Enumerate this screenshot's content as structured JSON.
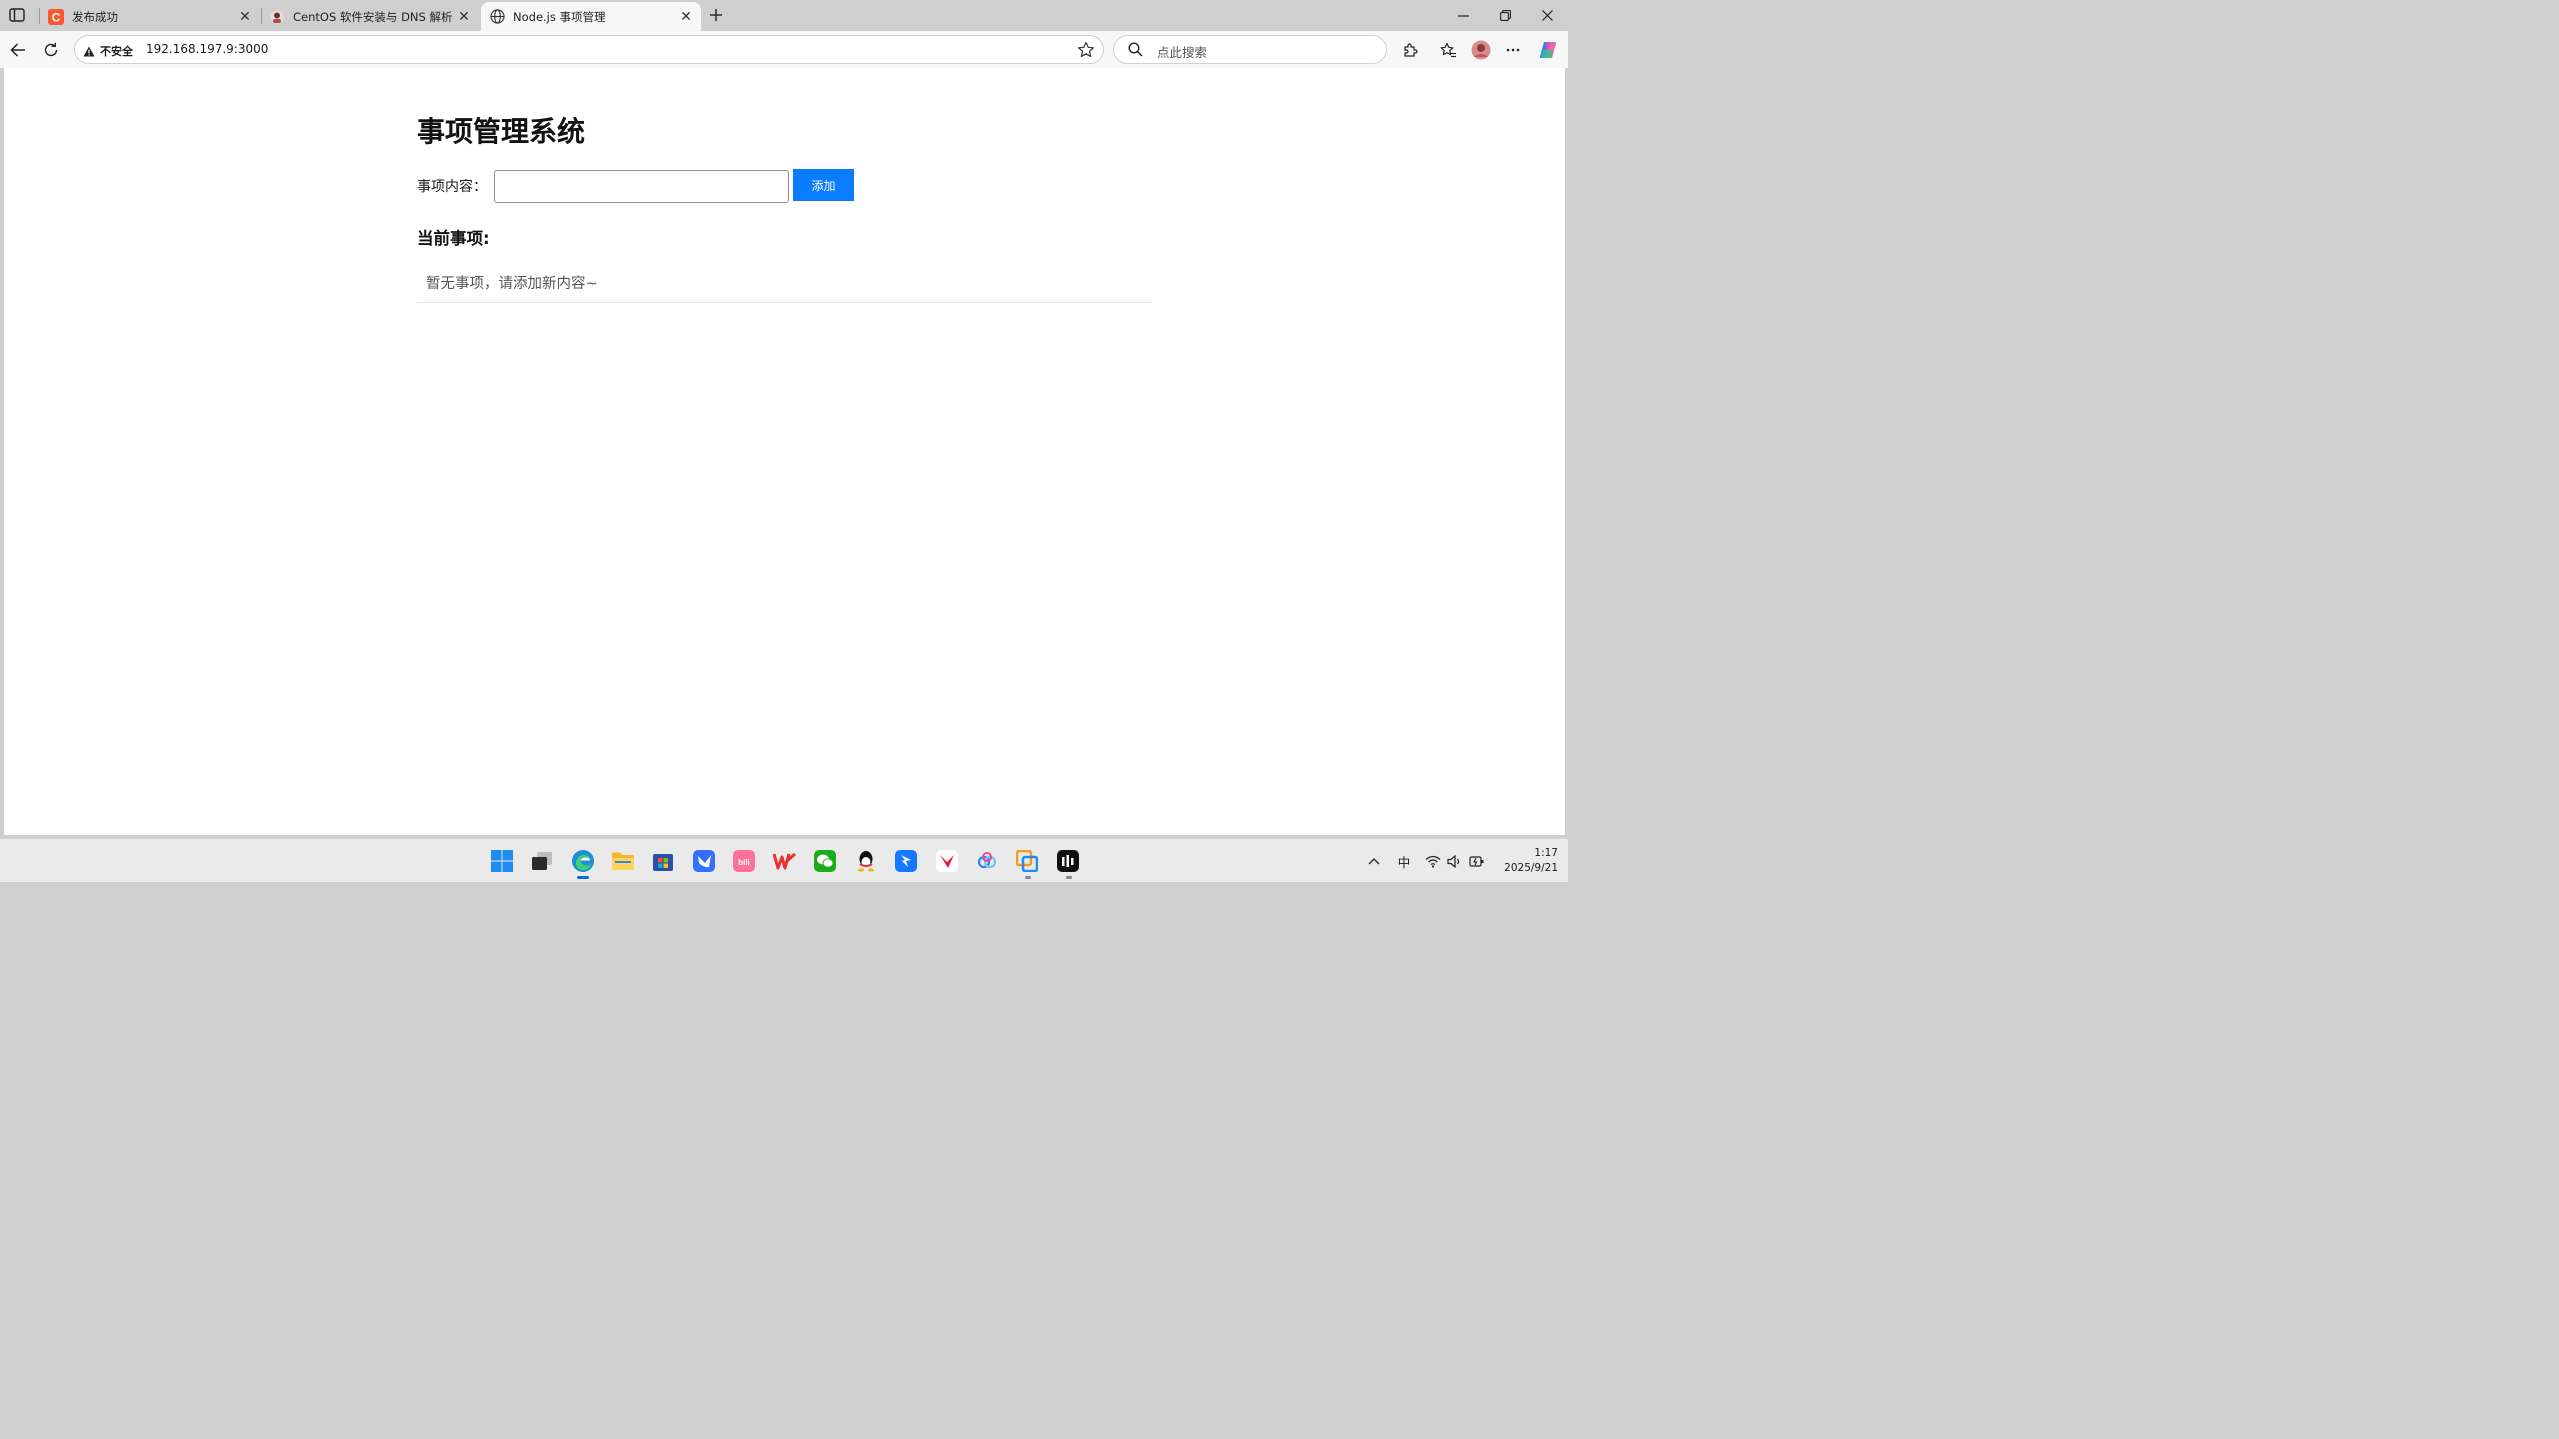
{
  "browser": {
    "tabs": [
      {
        "title": "发布成功",
        "active": false,
        "favicon": "csdn-icon"
      },
      {
        "title": "CentOS 软件安装与 DNS 解析 - 互",
        "active": false,
        "favicon": "avatar-icon"
      },
      {
        "title": "Node.js 事项管理",
        "active": true,
        "favicon": "globe-icon"
      }
    ],
    "address": {
      "security_label": "不安全",
      "url": "192.168.197.9:3000"
    },
    "search": {
      "placeholder": "点此搜索"
    }
  },
  "page": {
    "title": "事项管理系统",
    "form": {
      "label": "事项内容：",
      "input_value": "",
      "add_button": "添加"
    },
    "list_heading": "当前事项:",
    "empty_message": "暂无事项，请添加新内容~",
    "items": []
  },
  "taskbar": {
    "apps": [
      "start-icon",
      "task-view-icon",
      "edge-icon",
      "file-explorer-icon",
      "store-icon",
      "feishu-icon",
      "bilibili-icon",
      "wps-icon",
      "wechat-icon",
      "qq-icon",
      "dingtalk-icon",
      "youdao-icon",
      "baidu-netdisk-icon",
      "vmware-icon",
      "capcut-icon"
    ],
    "tray": {
      "ime": "中",
      "time": "1:17",
      "date": "2025/9/21"
    }
  },
  "colors": {
    "accent": "#0a7cff",
    "tab_strip": "#cfcfcf",
    "toolbar": "#f7f7f7"
  }
}
